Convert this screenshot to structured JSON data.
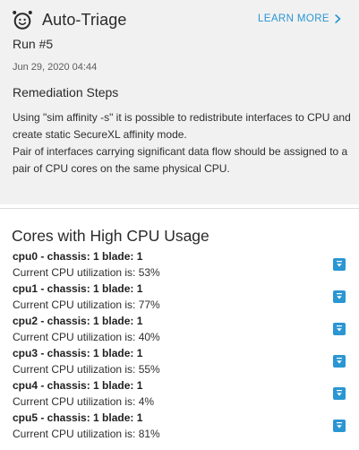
{
  "header": {
    "title": "Auto-Triage",
    "learn_more": "LEARN MORE",
    "logo_icon": "auto-triage-logo-icon",
    "chevron_icon": "chevron-right-icon"
  },
  "run": {
    "label": "Run #5",
    "date": "Jun 29, 2020 04:44"
  },
  "remediation": {
    "title": "Remediation Steps",
    "paragraphs": [
      "Using \"sim affinity -s\" it is possible to redistribute interfaces to CPU and create static SecureXL affinity mode.",
      "Pair of interfaces carrying significant data flow should be assigned to a pair of CPU cores on the same physical CPU."
    ]
  },
  "cores": {
    "title": "Cores with High CPU Usage",
    "expand_icon": "expand-down-icon",
    "items": [
      {
        "name": "cpu0 - chassis: 1 blade: 1",
        "utilization": "Current CPU utilization is: 53%"
      },
      {
        "name": "cpu1 - chassis: 1 blade: 1",
        "utilization": "Current CPU utilization is: 77%"
      },
      {
        "name": "cpu2 - chassis: 1 blade: 1",
        "utilization": "Current CPU utilization is: 40%"
      },
      {
        "name": "cpu3 - chassis: 1 blade: 1",
        "utilization": "Current CPU utilization is: 55%"
      },
      {
        "name": "cpu4 - chassis: 1 blade: 1",
        "utilization": "Current CPU utilization is: 4%"
      },
      {
        "name": "cpu5 - chassis: 1 blade: 1",
        "utilization": "Current CPU utilization is: 81%"
      }
    ]
  },
  "colors": {
    "accent": "#2a96d3",
    "panel_background": "#f1f1f1"
  }
}
